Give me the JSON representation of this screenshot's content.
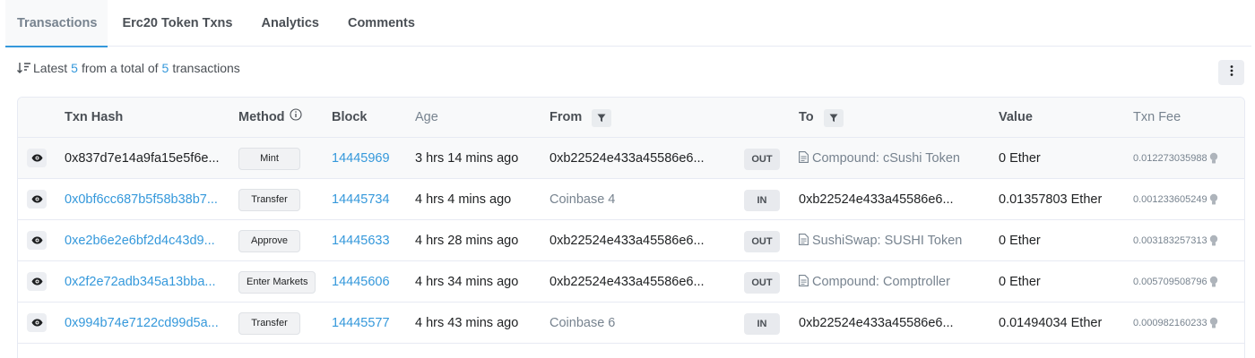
{
  "tabs": [
    {
      "label": "Transactions",
      "active": true
    },
    {
      "label": "Erc20 Token Txns",
      "active": false
    },
    {
      "label": "Analytics",
      "active": false
    },
    {
      "label": "Comments",
      "active": false
    }
  ],
  "summary": {
    "prefix": "Latest",
    "count": "5",
    "middle": "from a total of",
    "total": "5",
    "suffix": "transactions"
  },
  "columns": {
    "txn_hash": "Txn Hash",
    "method": "Method",
    "block": "Block",
    "age": "Age",
    "from": "From",
    "to": "To",
    "value": "Value",
    "txn_fee": "Txn Fee"
  },
  "rows": [
    {
      "hash": "0x837d7e14a9fa15e5f6e...",
      "method": "Mint",
      "block": "14445969",
      "age": "3 hrs 14 mins ago",
      "from": "0xb22524e433a45586e6...",
      "direction": "OUT",
      "to": "Compound: cSushi Token",
      "to_is_contract": true,
      "value": "0 Ether",
      "fee": "0.012273035988"
    },
    {
      "hash": "0x0bf6cc687b5f58b38b7...",
      "method": "Transfer",
      "block": "14445734",
      "age": "4 hrs 4 mins ago",
      "from": "Coinbase 4",
      "direction": "IN",
      "to": "0xb22524e433a45586e6...",
      "to_is_contract": false,
      "value": "0.01357803 Ether",
      "fee": "0.001233605249"
    },
    {
      "hash": "0xe2b6e2e6bf2d4c43d9...",
      "method": "Approve",
      "block": "14445633",
      "age": "4 hrs 28 mins ago",
      "from": "0xb22524e433a45586e6...",
      "direction": "OUT",
      "to": "SushiSwap: SUSHI Token",
      "to_is_contract": true,
      "value": "0 Ether",
      "fee": "0.003183257313"
    },
    {
      "hash": "0x2f2e72adb345a13bba...",
      "method": "Enter Markets",
      "block": "14445606",
      "age": "4 hrs 34 mins ago",
      "from": "0xb22524e433a45586e6...",
      "direction": "OUT",
      "to": "Compound: Comptroller",
      "to_is_contract": true,
      "value": "0 Ether",
      "fee": "0.005709508796"
    },
    {
      "hash": "0x994b74e7122cd99d5a...",
      "method": "Transfer",
      "block": "14445577",
      "age": "4 hrs 43 mins ago",
      "from": "Coinbase 6",
      "direction": "IN",
      "to": "0xb22524e433a45586e6...",
      "to_is_contract": false,
      "value": "0.01494034 Ether",
      "fee": "0.000982160233"
    }
  ],
  "colors": {
    "link": "#3498db",
    "text": "#1e2022",
    "muted": "#77838f",
    "border": "#e7eaf3",
    "row_highlight": "#f8f9fa"
  },
  "icons": {
    "sort": "sort-amount-icon",
    "more": "vertical-dots-icon",
    "info": "info-circle-icon",
    "filter": "filter-icon",
    "eye": "eye-icon",
    "contract": "file-contract-icon",
    "gas": "gas-bulb-icon"
  }
}
